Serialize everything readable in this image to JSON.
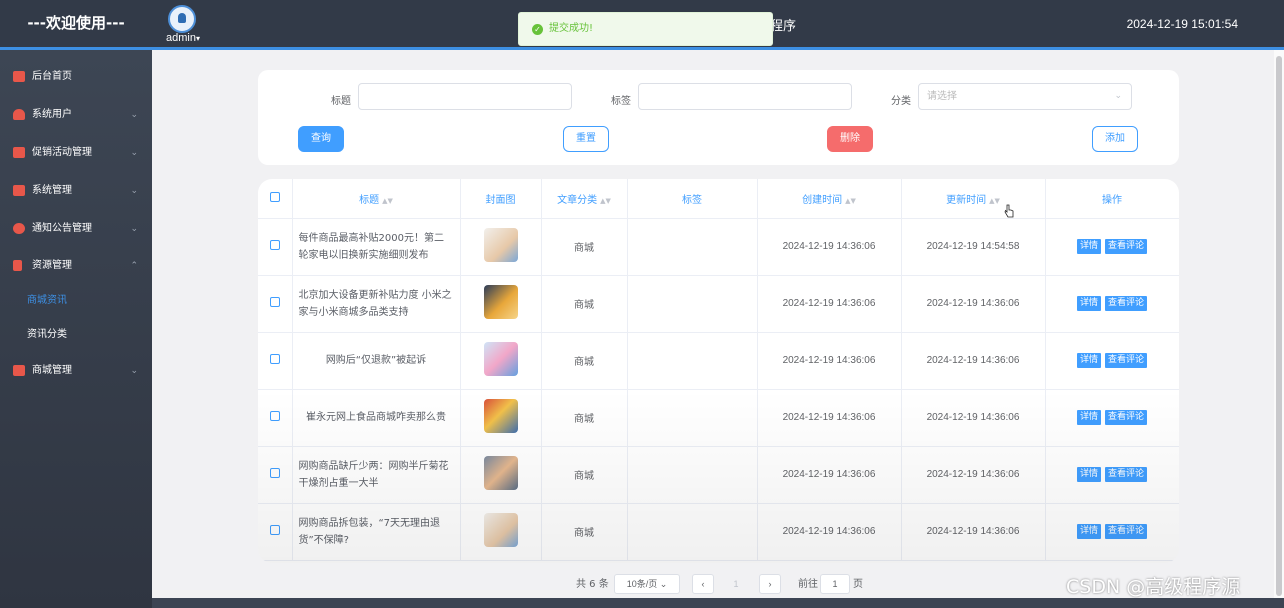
{
  "header": {
    "brand": "---欢迎使用---",
    "user": "admin",
    "app_title_fragment": "程序",
    "datetime": "2024-12-19 15:01:54"
  },
  "toast": {
    "message": "提交成功!"
  },
  "sidebar": {
    "items": [
      {
        "label": "后台首页",
        "icon": "monitor-icon"
      },
      {
        "label": "系统用户",
        "icon": "user-icon"
      },
      {
        "label": "促销活动管理",
        "icon": "chart-icon"
      },
      {
        "label": "系统管理",
        "icon": "bar-chart-icon"
      },
      {
        "label": "通知公告管理",
        "icon": "info-icon"
      },
      {
        "label": "资源管理",
        "icon": "flag-icon"
      },
      {
        "label": "商城管理",
        "icon": "monitor-icon"
      }
    ],
    "subitems": [
      {
        "label": "商城资讯",
        "active": true
      },
      {
        "label": "资讯分类",
        "active": false
      }
    ]
  },
  "filter": {
    "title_label": "标题",
    "tag_label": "标签",
    "category_label": "分类",
    "category_placeholder": "请选择",
    "query": "查询",
    "reset": "重置",
    "delete": "删除",
    "add": "添加"
  },
  "table": {
    "headers": [
      "标题",
      "封面图",
      "文章分类",
      "标签",
      "创建时间",
      "更新时间",
      "操作"
    ],
    "detail_btn": "详情",
    "comment_btn": "查看评论",
    "rows": [
      {
        "title": "每件商品最高补贴2000元！第二轮家电以旧换新实施细则发布",
        "category": "商城",
        "tag": "",
        "created": "2024-12-19 14:36:06",
        "updated": "2024-12-19 14:54:58"
      },
      {
        "title": "北京加大设备更新补贴力度 小米之家与小米商城多品类支持",
        "category": "商城",
        "tag": "",
        "created": "2024-12-19 14:36:06",
        "updated": "2024-12-19 14:36:06"
      },
      {
        "title": "网购后“仅退款”被起诉",
        "category": "商城",
        "tag": "",
        "created": "2024-12-19 14:36:06",
        "updated": "2024-12-19 14:36:06"
      },
      {
        "title": "崔永元网上食品商城咋卖那么贵",
        "category": "商城",
        "tag": "",
        "created": "2024-12-19 14:36:06",
        "updated": "2024-12-19 14:36:06"
      },
      {
        "title": "网购商品缺斤少两：网购半斤菊花 干燥剂占重一大半",
        "category": "商城",
        "tag": "",
        "created": "2024-12-19 14:36:06",
        "updated": "2024-12-19 14:36:06"
      },
      {
        "title": "网购商品拆包装，“7天无理由退货”不保障?",
        "category": "商城",
        "tag": "",
        "created": "2024-12-19 14:36:06",
        "updated": "2024-12-19 14:36:06"
      }
    ]
  },
  "pagination": {
    "total": "共 6 条",
    "page_size": "10条/页",
    "current": "1",
    "goto_prefix": "前往",
    "goto_value": "1",
    "goto_suffix": "页"
  },
  "watermark": "CSDN @高级程序源",
  "colors": {
    "accent": "#409eff",
    "danger": "#f56c6c",
    "sidebar": "#3d4654",
    "success": "#67c23a"
  }
}
